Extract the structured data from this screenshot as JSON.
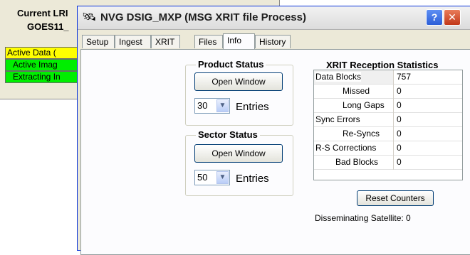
{
  "background_window": {
    "title_line1": "Current LRI",
    "title_line2": "GOES11_",
    "status_items": [
      "Active Data (",
      "Active Imag",
      "Extracting In"
    ]
  },
  "window": {
    "title": "NVG DSIG_MXP   (MSG XRIT file Process)",
    "help_label": "?",
    "close_label": "✕",
    "app_icon": "satellite-icon"
  },
  "tabs": [
    "Setup",
    "Ingest",
    "XRIT",
    "Files",
    "Info",
    "History"
  ],
  "active_tab": "Info",
  "product_status": {
    "title": "Product Status",
    "button_label": "Open Window",
    "entries_value": "30",
    "entries_label": "Entries"
  },
  "sector_status": {
    "title": "Sector Status",
    "button_label": "Open Window",
    "entries_value": "50",
    "entries_label": "Entries"
  },
  "xrit_stats": {
    "title": "XRIT Reception Statistics",
    "rows": [
      {
        "label": "Data Blocks",
        "value": "757"
      },
      {
        "label": "Missed",
        "value": "0"
      },
      {
        "label": "Long Gaps",
        "value": "0"
      },
      {
        "label": "Sync Errors",
        "value": "0"
      },
      {
        "label": "Re-Syncs",
        "value": "0"
      },
      {
        "label": "R-S Corrections",
        "value": "0"
      },
      {
        "label": "Bad Blocks",
        "value": "0"
      }
    ],
    "reset_label": "Reset Counters",
    "disseminating": "Disseminating Satellite: 0"
  }
}
